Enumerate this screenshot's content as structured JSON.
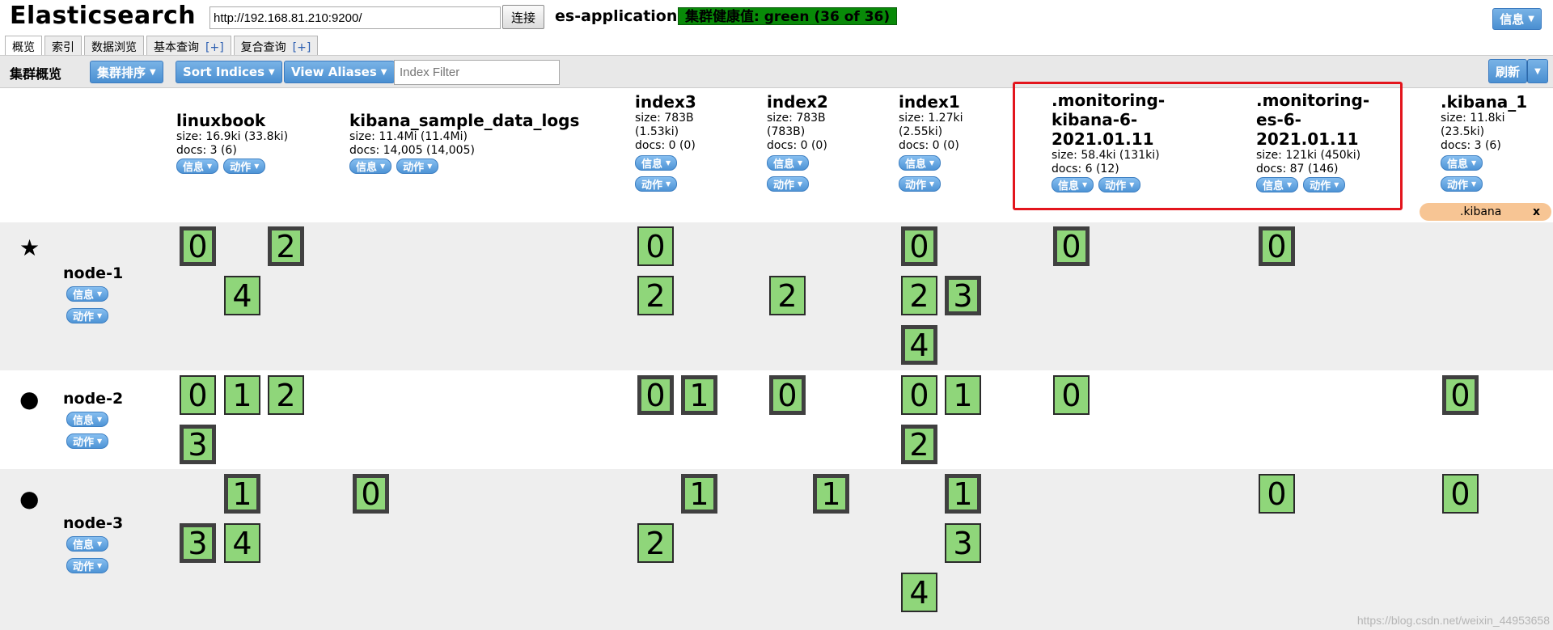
{
  "header": {
    "title": "Elasticsearch",
    "url": "http://192.168.81.210:9200/",
    "connect_label": "连接",
    "cluster_name": "es-application",
    "health_text": "集群健康值: green (36 of 36)",
    "health_color": "#088a08",
    "info_label": "信息"
  },
  "tabs": [
    {
      "label": "概览",
      "active": true
    },
    {
      "label": "索引"
    },
    {
      "label": "数据浏览"
    },
    {
      "label": "基本查询",
      "plus": "[+]"
    },
    {
      "label": "复合查询",
      "plus": "[+]"
    }
  ],
  "toolbar": {
    "title": "集群概览",
    "sort_cluster_label": "集群排序",
    "sort_indices_label": "Sort Indices",
    "view_aliases_label": "View Aliases",
    "index_filter_placeholder": "Index Filter",
    "refresh_label": "刷新"
  },
  "buttons": {
    "info": "信息",
    "action": "动作"
  },
  "indices": [
    {
      "name": "linuxbook",
      "size": "size: 16.9ki (33.8ki)",
      "docs": "docs: 3 (6)"
    },
    {
      "name": "kibana_sample_data_logs",
      "size": "size: 11.4Mi (11.4Mi)",
      "docs": "docs: 14,005 (14,005)"
    },
    {
      "name": "index3",
      "size_line1": "size: 783B",
      "size_line2": "(1.53ki)",
      "docs": "docs: 0 (0)"
    },
    {
      "name": "index2",
      "size_line1": "size: 783B",
      "size_line2": "(783B)",
      "docs": "docs: 0 (0)"
    },
    {
      "name": "index1",
      "size_line1": "size: 1.27ki",
      "size_line2": "(2.55ki)",
      "docs": "docs: 0 (0)"
    },
    {
      "name_line1": ".monitoring-",
      "name_line2": "kibana-6-",
      "name_line3": "2021.01.11",
      "size": "size: 58.4ki (131ki)",
      "docs": "docs: 6 (12)"
    },
    {
      "name_line1": ".monitoring-",
      "name_line2": "es-6-",
      "name_line3": "2021.01.11",
      "size": "size: 121ki (450ki)",
      "docs": "docs: 87 (146)"
    },
    {
      "name": ".kibana_1",
      "size_line1": "size: 11.8ki",
      "size_line2": "(23.5ki)",
      "docs": "docs: 3 (6)",
      "alias": ".kibana",
      "alias_close": "x"
    }
  ],
  "nodes": [
    {
      "name": "node-1",
      "icon": "star-icon",
      "master": true
    },
    {
      "name": "node-2",
      "icon": "circle-icon"
    },
    {
      "name": "node-3",
      "icon": "circle-icon"
    }
  ],
  "shards": {
    "node1": {
      "linuxbook": [
        "0",
        "2",
        "4"
      ],
      "index3": [
        "0",
        "2"
      ],
      "index2": [
        "2"
      ],
      "index1": [
        "0",
        "2",
        "3",
        "4"
      ],
      "monitoring_kibana": [
        "0"
      ],
      "monitoring_es": [
        "0"
      ]
    },
    "node2": {
      "linuxbook": [
        "0",
        "1",
        "2",
        "3"
      ],
      "index3": [
        "0",
        "1"
      ],
      "index2": [
        "0"
      ],
      "index1": [
        "0",
        "1",
        "2"
      ],
      "monitoring_kibana": [
        "0"
      ],
      "kibana_1": [
        "0"
      ]
    },
    "node3": {
      "linuxbook": [
        "1",
        "3",
        "4"
      ],
      "kibana_sample_data_logs": [
        "0"
      ],
      "index3": [
        "1",
        "2"
      ],
      "index2": [
        "1"
      ],
      "index1": [
        "1",
        "3",
        "4"
      ],
      "monitoring_es": [
        "0"
      ],
      "kibana_1": [
        "0"
      ]
    }
  },
  "watermark": "https://blog.csdn.net/weixin_44953658"
}
